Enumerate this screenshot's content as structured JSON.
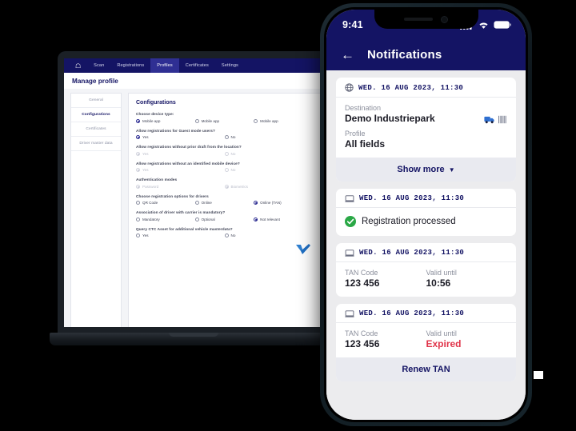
{
  "laptop": {
    "nav": {
      "home_icon": "home-icon",
      "items": [
        {
          "label": "Scan",
          "active": false
        },
        {
          "label": "Registrations",
          "active": false
        },
        {
          "label": "Profiles",
          "active": true
        },
        {
          "label": "Certificates",
          "active": false
        },
        {
          "label": "Settings",
          "active": false
        }
      ]
    },
    "page_title": "Manage profile",
    "side_menu": [
      {
        "label": "General",
        "active": false
      },
      {
        "label": "Configurations",
        "active": true
      },
      {
        "label": "Certificates",
        "active": false
      },
      {
        "label": "Driver master data",
        "active": false
      }
    ],
    "section_title": "Configurations",
    "fields": [
      {
        "label": "Choose device type:",
        "options": [
          {
            "label": "Mobile app",
            "selected": true,
            "disabled": false
          },
          {
            "label": "Mobile app",
            "selected": false,
            "disabled": false
          },
          {
            "label": "Mobile app",
            "selected": false,
            "disabled": false
          }
        ]
      },
      {
        "label": "Allow registrations for Guest mode users?",
        "options": [
          {
            "label": "Yes",
            "selected": true,
            "disabled": false
          },
          {
            "label": "No",
            "selected": false,
            "disabled": false
          }
        ]
      },
      {
        "label": "Allow registrations without prior draft from the location?",
        "options": [
          {
            "label": "Yes",
            "selected": true,
            "disabled": true
          },
          {
            "label": "No",
            "selected": false,
            "disabled": true
          }
        ]
      },
      {
        "label": "Allow registrations without an identified mobile device?",
        "options": [
          {
            "label": "Yes",
            "selected": true,
            "disabled": true
          },
          {
            "label": "No",
            "selected": false,
            "disabled": true
          }
        ]
      },
      {
        "label": "Authentication modes",
        "options": [
          {
            "label": "Password",
            "selected": true,
            "disabled": true
          },
          {
            "label": "Biometrics",
            "selected": true,
            "disabled": true
          }
        ]
      },
      {
        "label": "Choose registration options for drivers",
        "options": [
          {
            "label": "QR Code",
            "selected": false,
            "disabled": false
          },
          {
            "label": "Online",
            "selected": false,
            "disabled": false
          },
          {
            "label": "Online (TAN)",
            "selected": true,
            "disabled": false
          }
        ]
      },
      {
        "label": "Association of driver with carrier is mandatory?",
        "options": [
          {
            "label": "Mandatory",
            "selected": false,
            "disabled": false
          },
          {
            "label": "Optional",
            "selected": false,
            "disabled": false
          },
          {
            "label": "Not relevant",
            "selected": true,
            "disabled": false
          }
        ]
      },
      {
        "label": "Query CTC Asset for additional vehicle masterdata?",
        "options": [
          {
            "label": "Yes",
            "selected": false,
            "disabled": false
          },
          {
            "label": "No",
            "selected": false,
            "disabled": false
          }
        ]
      }
    ],
    "footer_logo": "checkmark-logo"
  },
  "phone": {
    "status": {
      "time": "9:41",
      "signal_icon": "cellular-signal-icon",
      "wifi_icon": "wifi-icon",
      "battery_icon": "battery-icon"
    },
    "header": {
      "back_icon": "back-arrow-icon",
      "title": "Notifications"
    },
    "cards": [
      {
        "type": "destination",
        "head_icon": "globe-icon",
        "date": "WED. 16 AUG 2023, 11:30",
        "fields": [
          {
            "label": "Destination",
            "value": "Demo Industriepark"
          },
          {
            "label": "Profile",
            "value": "All fields"
          }
        ],
        "row_icons": [
          "truck-icon",
          "barcode-icon"
        ],
        "button": {
          "label": "Show more",
          "chevron": "chevron-down-icon"
        }
      },
      {
        "type": "status",
        "head_icon": "device-icon",
        "date": "WED. 16 AUG 2023, 11:30",
        "status_icon": "check-circle-icon",
        "status_text": "Registration processed"
      },
      {
        "type": "tan",
        "head_icon": "device-icon",
        "date": "WED. 16 AUG 2023, 11:30",
        "fields": [
          {
            "label": "TAN Code",
            "value": "123 456"
          },
          {
            "label": "Valid until",
            "value": "10:56",
            "expired": false
          }
        ]
      },
      {
        "type": "tan-expired",
        "head_icon": "device-icon",
        "date": "WED. 16 AUG 2023, 11:30",
        "fields": [
          {
            "label": "TAN Code",
            "value": "123 456"
          },
          {
            "label": "Valid until",
            "value": "Expired",
            "expired": true
          }
        ],
        "button": {
          "label": "Renew TAN"
        }
      }
    ]
  },
  "colors": {
    "brand_navy": "#141464",
    "accent_blue": "#2f2f93",
    "danger_red": "#e0344a",
    "success_green": "#2aa846",
    "page_bg": "#000000"
  }
}
